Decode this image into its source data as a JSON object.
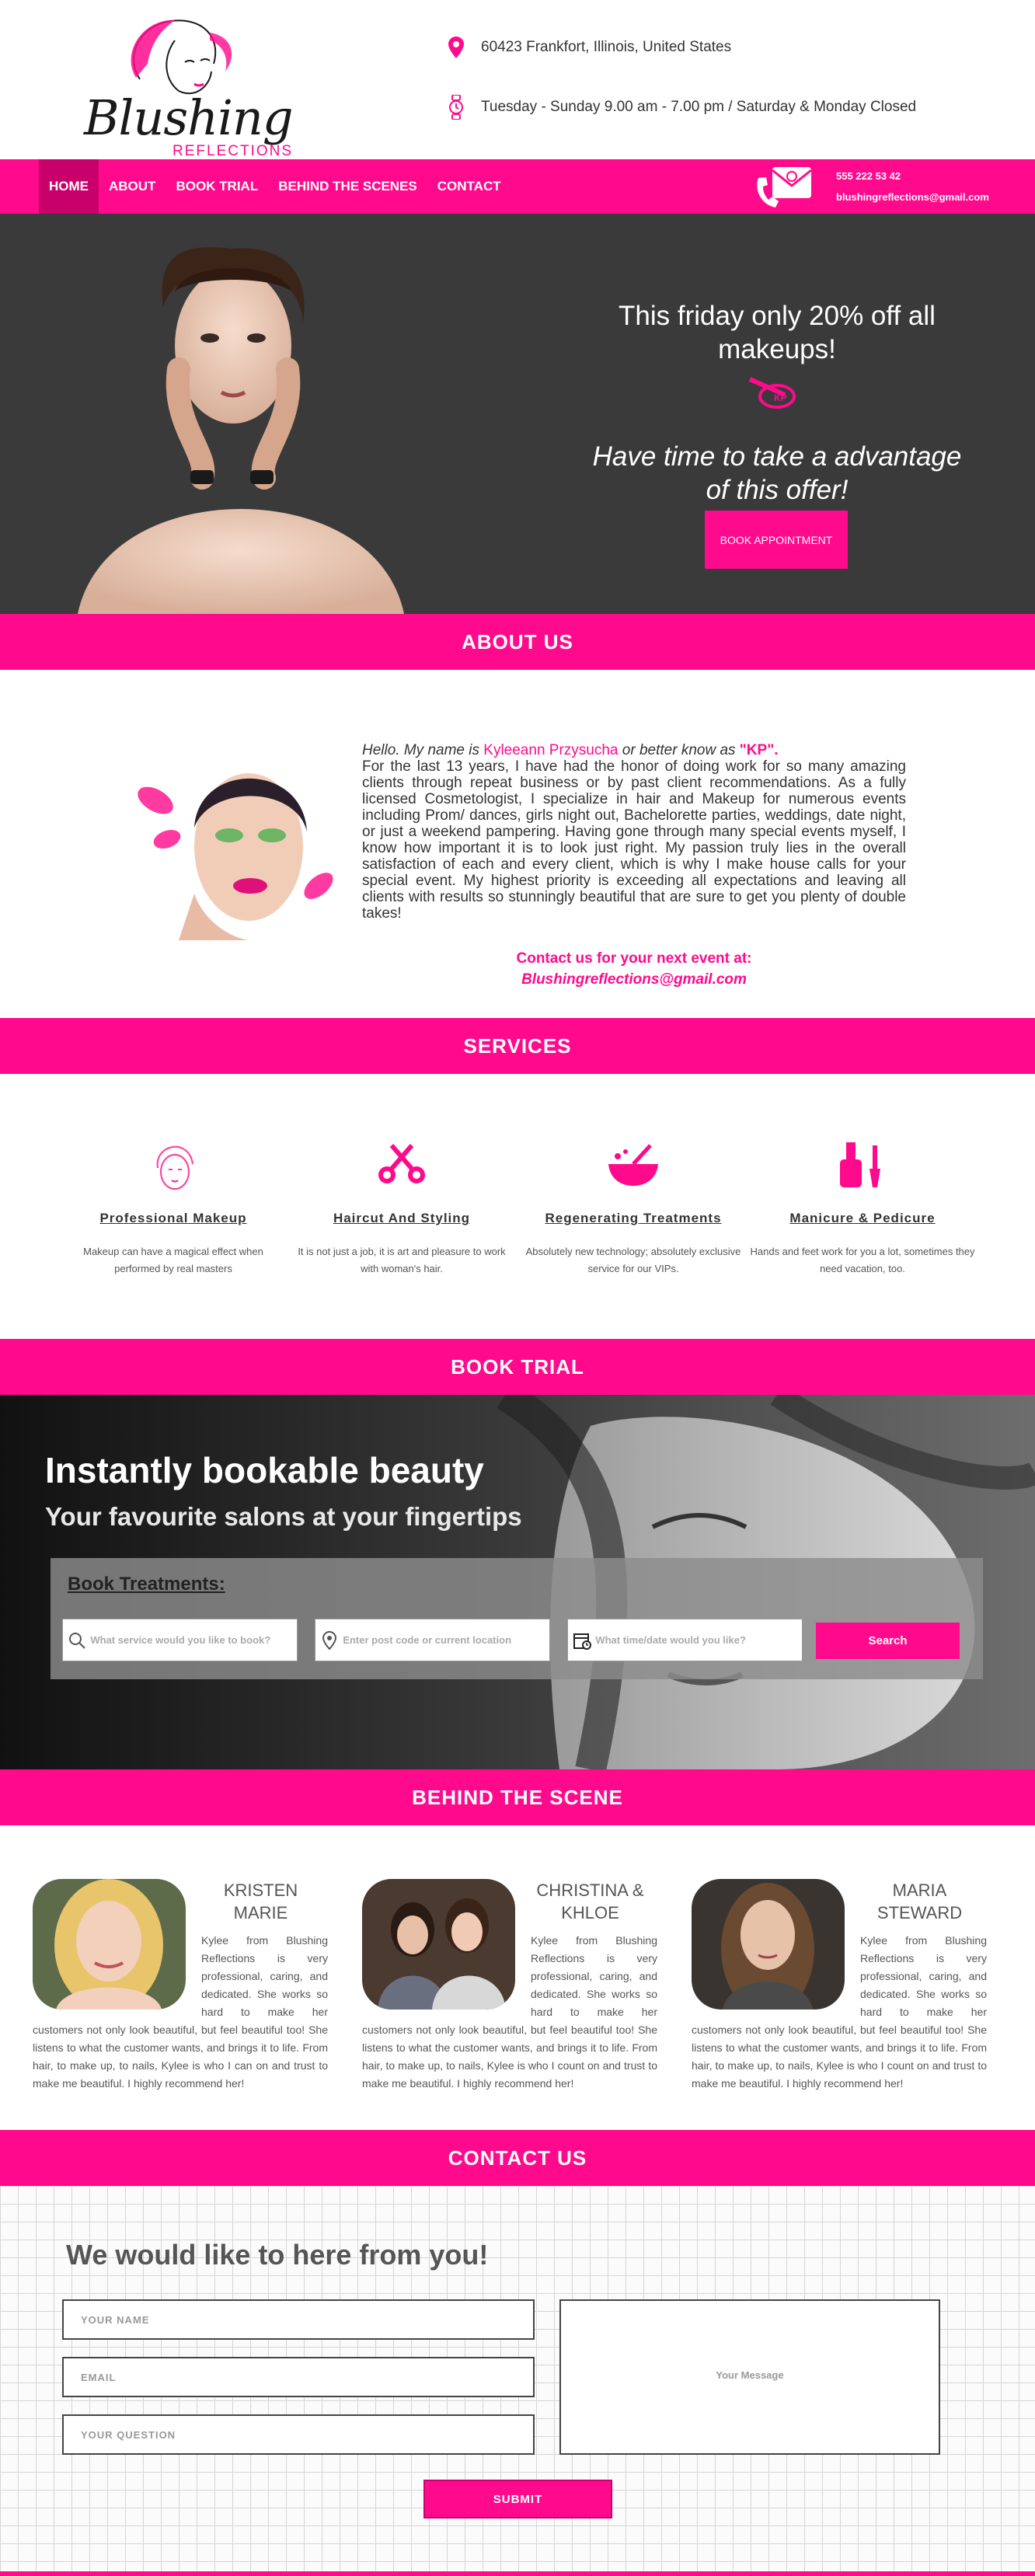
{
  "brand": {
    "name": "Blushing",
    "subname": "REFLECTIONS"
  },
  "header": {
    "address": "60423 Frankfort, Illinois, United States",
    "hours": "Tuesday - Sunday 9.00 am - 7.00 pm / Saturday & Monday Closed"
  },
  "nav": {
    "items": [
      "HOME",
      "ABOUT",
      "BOOK TRIAL",
      "BEHIND THE SCENES",
      "CONTACT"
    ],
    "active": "HOME",
    "phone": "555 222 53 42",
    "email": "blushingreflections@gmail.com"
  },
  "hero": {
    "headline": "This friday only 20% off all makeups!",
    "tagline": "Have time to take a advantage of this offer!",
    "button": "BOOK APPOINTMENT"
  },
  "about": {
    "heading": "ABOUT US",
    "intro_1": "Hello. My name is ",
    "name": "Kyleeann Przysucha",
    "intro_2": " or better know as ",
    "nickname": "\"KP\".",
    "body": "For the last 13 years, I have had the honor of doing work for so many amazing clients through repeat business or by past client recommendations. As a fully licensed Cosmetologist, I specialize in hair and Makeup for numerous events including Prom/ dances, girls night out, Bachelorette parties, weddings, date night, or just a weekend pampering. Having gone through many special events myself, I know how important it is to look just right. My passion truly lies in the overall satisfaction of each and every client, which is why I make house calls for your special event. My highest priority is exceeding all expectations and leaving all clients with results so stunningly beautiful that are sure to get you plenty of double takes!",
    "contact_line": "Contact us for your next event at:",
    "contact_email": "Blushingreflections@gmail.com"
  },
  "services": {
    "heading": "SERVICES",
    "items": [
      {
        "title": "Professional Makeup",
        "desc": "Makeup can have a magical effect when performed by real masters",
        "icon": "face-makeup-icon"
      },
      {
        "title": "Haircut And Styling",
        "desc": "It is not just a job, it is art and pleasure to work with woman's hair.",
        "icon": "scissors-icon"
      },
      {
        "title": "Regenerating Treatments",
        "desc": "Absolutely new technology; absolutely exclusive service for our VIPs.",
        "icon": "spa-bowl-icon"
      },
      {
        "title": "Manicure & Pedicure",
        "desc": "Hands and feet work for you a lot, sometimes they need vacation, too.",
        "icon": "nail-polish-icon"
      }
    ]
  },
  "book": {
    "heading": "BOOK TRIAL",
    "title": "Instantly bookable beauty",
    "subtitle": "Your favourite salons at your fingertips",
    "panel_label": "Book Treatments:",
    "service_placeholder": "What service would you like to book?",
    "location_placeholder": "Enter post code or current location",
    "time_placeholder": "What time/date would you like?",
    "search": "Search"
  },
  "team": {
    "heading": "BEHIND THE SCENE",
    "members": [
      {
        "name": "KRISTEN MARIE",
        "bio": "Kylee from Blushing Reflections is very professional, caring, and dedicated. She works so hard to make her customers not only look beautiful, but feel beautiful too! She listens to what the customer wants, and brings it to life. From hair, to make up, to nails, Kylee is who I can on and trust to make me beautiful. I highly recommend her!"
      },
      {
        "name": "CHRISTINA & KHLOE",
        "bio": "Kylee from Blushing Reflections is very professional, caring, and dedicated. She works so hard to make her customers not only look beautiful, but feel beautiful too! She listens to what the customer wants, and brings it to life. From hair, to make up, to nails, Kylee is who I count on and trust to make me beautiful. I highly recommend her!"
      },
      {
        "name": "MARIA STEWARD",
        "bio": "Kylee from Blushing Reflections is very professional, caring, and dedicated. She works so hard to make her customers not only look beautiful, but feel beautiful too! She listens to what the customer wants, and brings it to life. From hair, to make up, to nails, Kylee is who I count on and trust to make me beautiful. I highly recommend her!"
      }
    ]
  },
  "contact": {
    "heading": "CONTACT US",
    "title": "We would like to here from you!",
    "name_placeholder": "YOUR NAME",
    "email_placeholder": "EMAIL",
    "question_placeholder": "YOUR QUESTION",
    "message_placeholder": "Your Message",
    "submit": "SUBMIT"
  },
  "colors": {
    "accent": "#ff0a8c",
    "accent_dark": "#c9006b",
    "hero_bg": "#3a3a3a"
  }
}
